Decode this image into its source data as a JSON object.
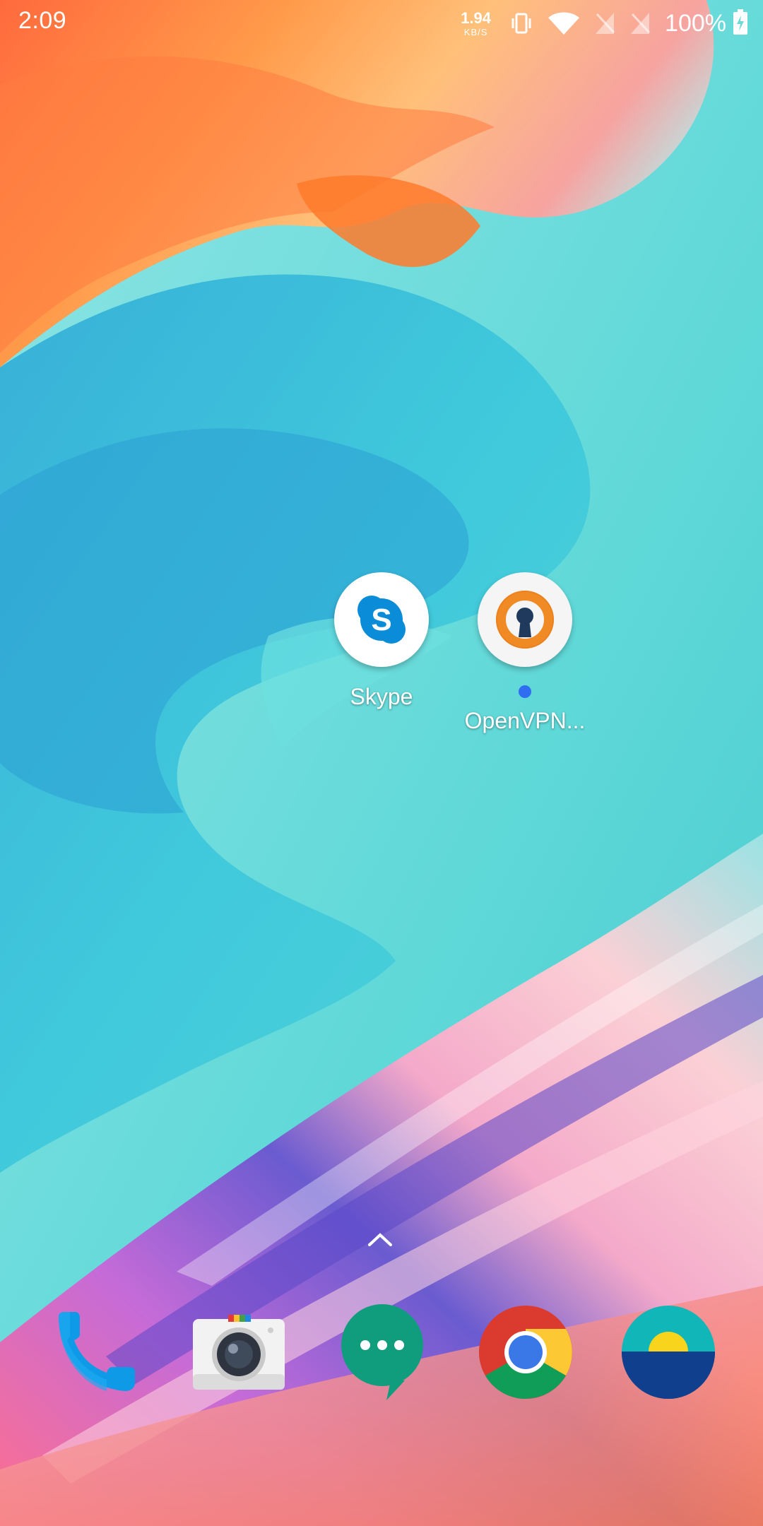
{
  "status_bar": {
    "time": "2:09",
    "net_speed_value": "1.94",
    "net_speed_unit": "KB/S",
    "battery_percent": "100%",
    "icons": [
      "vibrate-icon",
      "wifi-icon",
      "no-sim-icon",
      "no-sim-icon",
      "battery-charging-icon"
    ]
  },
  "home": {
    "apps": [
      {
        "label": "Skype",
        "icon": "skype-icon",
        "brand_color": "#0a8cd8"
      },
      {
        "label": "OpenVPN...",
        "icon": "openvpn-icon",
        "brand_color": "#f08a24",
        "has_notification_dot": true
      }
    ],
    "drawer_handle": "chevron-up-icon"
  },
  "dock": {
    "items": [
      {
        "name": "phone",
        "icon": "phone-icon"
      },
      {
        "name": "camera",
        "icon": "camera-icon"
      },
      {
        "name": "messaging",
        "icon": "messages-icon"
      },
      {
        "name": "chrome",
        "icon": "chrome-icon"
      },
      {
        "name": "weather",
        "icon": "weather-icon"
      }
    ]
  }
}
